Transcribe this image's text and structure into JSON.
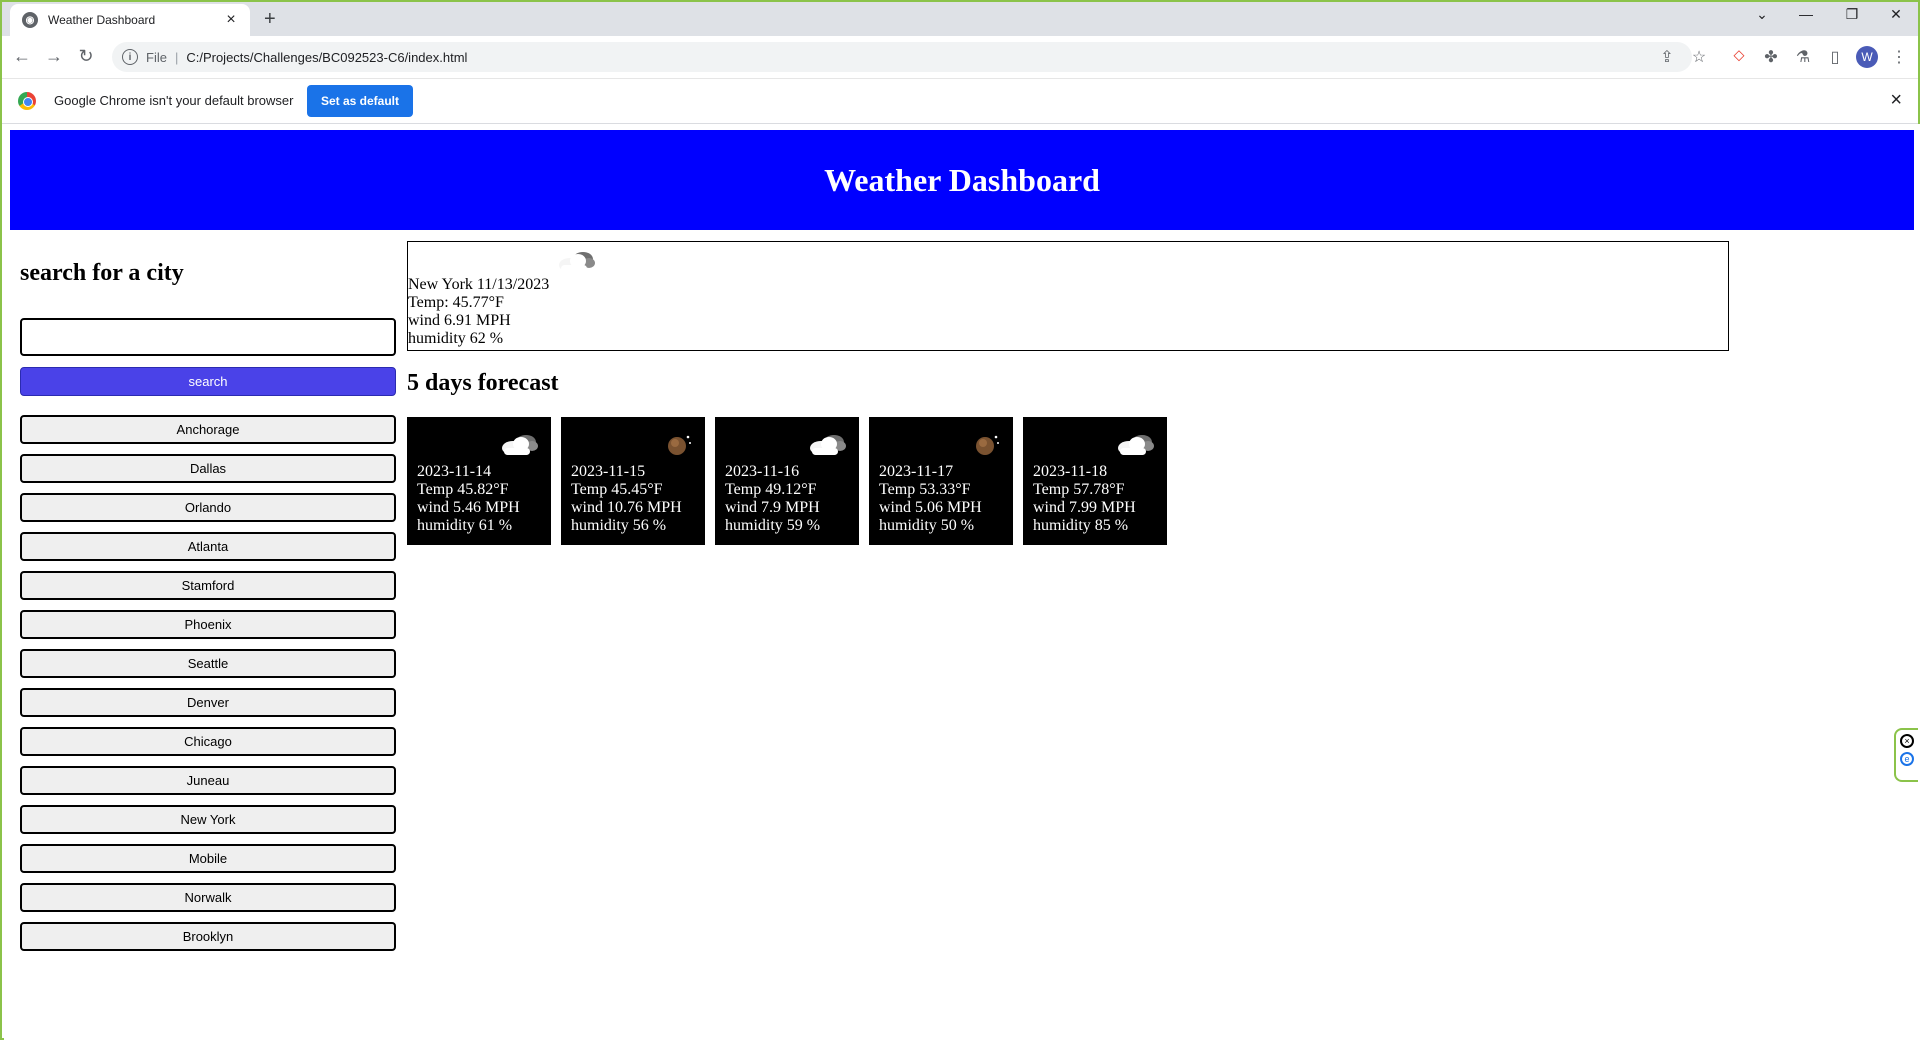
{
  "browser": {
    "tab_title": "Weather Dashboard",
    "url_scheme": "File",
    "url": "C:/Projects/Challenges/BC092523-C6/index.html",
    "avatar_letter": "W",
    "infobar_message": "Google Chrome isn't your default browser",
    "set_default_label": "Set as default"
  },
  "header": {
    "title": "Weather Dashboard"
  },
  "sidebar": {
    "title": "search for a city",
    "search_value": "",
    "search_button": "search",
    "cities": [
      "Anchorage",
      "Dallas",
      "Orlando",
      "Atlanta",
      "Stamford",
      "Phoenix",
      "Seattle",
      "Denver",
      "Chicago",
      "Juneau",
      "New York",
      "Mobile",
      "Norwalk",
      "Brooklyn"
    ]
  },
  "current": {
    "icon": "cloudy-icon",
    "city_date": "New York 11/13/2023",
    "temp": "Temp: 45.77°F",
    "wind": "wind 6.91 MPH",
    "humidity": "humidity 62 %"
  },
  "forecast": {
    "title": "5 days forecast",
    "days": [
      {
        "icon": "cloudy-icon",
        "date": "2023-11-14",
        "temp": "Temp 45.82°F",
        "wind": "wind 5.46 MPH",
        "humidity": "humidity 61 %"
      },
      {
        "icon": "clear-night-icon",
        "date": "2023-11-15",
        "temp": "Temp 45.45°F",
        "wind": "wind 10.76 MPH",
        "humidity": "humidity 56 %"
      },
      {
        "icon": "cloudy-icon",
        "date": "2023-11-16",
        "temp": "Temp 49.12°F",
        "wind": "wind 7.9 MPH",
        "humidity": "humidity 59 %"
      },
      {
        "icon": "clear-night-icon",
        "date": "2023-11-17",
        "temp": "Temp 53.33°F",
        "wind": "wind 5.06 MPH",
        "humidity": "humidity 50 %"
      },
      {
        "icon": "cloudy-icon",
        "date": "2023-11-18",
        "temp": "Temp 57.78°F",
        "wind": "wind 7.99 MPH",
        "humidity": "humidity 85 %"
      }
    ]
  },
  "colors": {
    "header_bg": "#0000ff",
    "search_button_bg": "#4a42e8",
    "card_bg": "#000000"
  }
}
